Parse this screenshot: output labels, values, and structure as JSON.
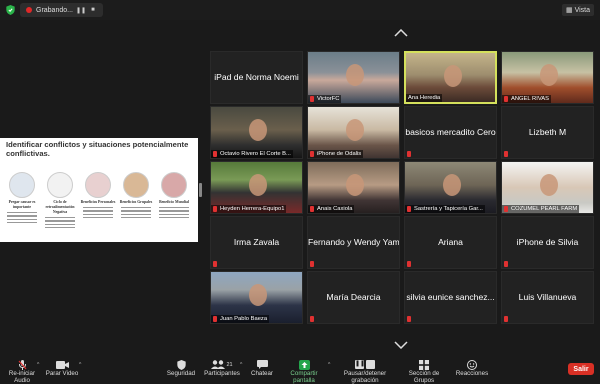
{
  "topbar": {
    "recording_label": "Grabando...",
    "view_label": "Vista"
  },
  "share": {
    "title": "Identificar conflictos y situaciones potencialmente conflictivas.",
    "items": [
      {
        "caption": "Pregar causar es importante"
      },
      {
        "caption": "Ciclo de retroalimentación Negativa"
      },
      {
        "caption": "Beneficios Personales"
      },
      {
        "caption": "Beneficios Grupales"
      },
      {
        "caption": "Beneficio Mundial"
      }
    ]
  },
  "participants": [
    {
      "name": "iPad de Norma Noemi",
      "type": "name",
      "muted": false
    },
    {
      "name": "VictorFC",
      "type": "video",
      "muted": true
    },
    {
      "name": "Ana Heredia",
      "type": "video",
      "muted": false,
      "speaking": true
    },
    {
      "name": "ANGEL RIVAS",
      "type": "video",
      "muted": true
    },
    {
      "name": "Octavio Rivero El Corte B...",
      "type": "video",
      "muted": true
    },
    {
      "name": "iPhone de Odalis",
      "type": "video",
      "muted": true
    },
    {
      "name": "basicos mercadito Cero",
      "type": "name",
      "muted": true
    },
    {
      "name": "Lizbeth M",
      "type": "name",
      "muted": true
    },
    {
      "name": "Heyden Herrera-Equipo1",
      "type": "video",
      "muted": true
    },
    {
      "name": "Anais Caxiola",
      "type": "video",
      "muted": true
    },
    {
      "name": "Sastrería y Tapicería Gar...",
      "type": "video",
      "muted": true
    },
    {
      "name": "COZUMEL PEARL FARM",
      "type": "video",
      "muted": true
    },
    {
      "name": "Irma Zavala",
      "type": "name",
      "muted": true
    },
    {
      "name": "Fernando y Wendy Yam",
      "type": "name",
      "muted": true
    },
    {
      "name": "Ariana",
      "type": "name",
      "muted": true
    },
    {
      "name": "iPhone de Silvia",
      "type": "name",
      "muted": true
    },
    {
      "name": "Juan Pablo Baeza",
      "type": "video",
      "muted": true
    },
    {
      "name": "María Dearcia",
      "type": "name",
      "muted": true
    },
    {
      "name": "silvia eunice sanchez...",
      "type": "name",
      "muted": true
    },
    {
      "name": "Luis Villanueva",
      "type": "name",
      "muted": true
    }
  ],
  "toolbar": {
    "unmute": "Re-iniciar Audio",
    "video": "Parar Video",
    "security": "Seguridad",
    "participants": "Participantes",
    "participants_count": "21",
    "chat": "Chatear",
    "share": "Compartir pantalla",
    "record": "Pausar/detener grabación",
    "breakout": "Sección de Grupos",
    "reactions": "Reacciones",
    "end": "Salir"
  },
  "colors": {
    "share_green": "#23a54b",
    "speaking_border": "#d4e05c",
    "end_red": "#d93025"
  }
}
